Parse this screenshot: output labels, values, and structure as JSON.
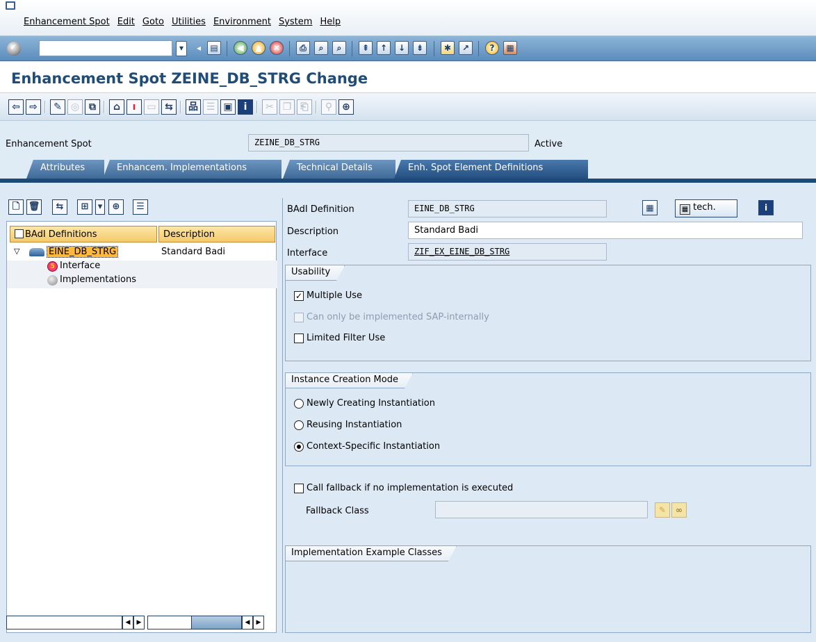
{
  "menu": {
    "items": [
      "Enhancement Spot",
      "Edit",
      "Goto",
      "Utilities",
      "Environment",
      "System",
      "Help"
    ]
  },
  "system_toolbar": {
    "command_value": "",
    "icons": [
      "back-arrow-icon",
      "save-icon",
      "back-icon",
      "exit-icon",
      "cancel-icon",
      "print-icon",
      "find-icon",
      "find-next-icon",
      "first-page-icon",
      "previous-page-icon",
      "next-page-icon",
      "last-page-icon",
      "create-session-icon",
      "shortcut-icon",
      "help-icon",
      "layout-icon"
    ]
  },
  "title": "Enhancement Spot ZEINE_DB_STRG Change",
  "header": {
    "spot_label": "Enhancement Spot",
    "spot_value": "ZEINE_DB_STRG",
    "status": "Active"
  },
  "tabs": [
    "Attributes",
    "Enhancem. Implementations",
    "Technical Details",
    "Enh. Spot Element Definitions"
  ],
  "tree": {
    "col1": "BAdI Definitions",
    "col2": "Description",
    "root_label": "EINE_DB_STRG",
    "root_desc": "Standard Badi",
    "child1": "Interface",
    "child2": "Implementations"
  },
  "detail": {
    "badi_label": "BAdI Definition",
    "badi_value": "EINE_DB_STRG",
    "tech_button": "tech.",
    "desc_label": "Description",
    "desc_value": "Standard Badi",
    "intf_label": "Interface",
    "intf_value": "ZIF_EX_EINE_DB_STRG",
    "usability_title": "Usability",
    "multiple_use": "Multiple Use",
    "sap_internal": "Can only be implemented SAP-internally",
    "limited_filter": "Limited Filter Use",
    "instance_title": "Instance Creation Mode",
    "inst_new": "Newly Creating Instantiation",
    "inst_reuse": "Reusing Instantiation",
    "inst_context": "Context-Specific Instantiation",
    "fallback_check": "Call fallback if no implementation is executed",
    "fallback_label": "Fallback Class",
    "fallback_value": "",
    "examples_title": "Implementation Example Classes"
  }
}
